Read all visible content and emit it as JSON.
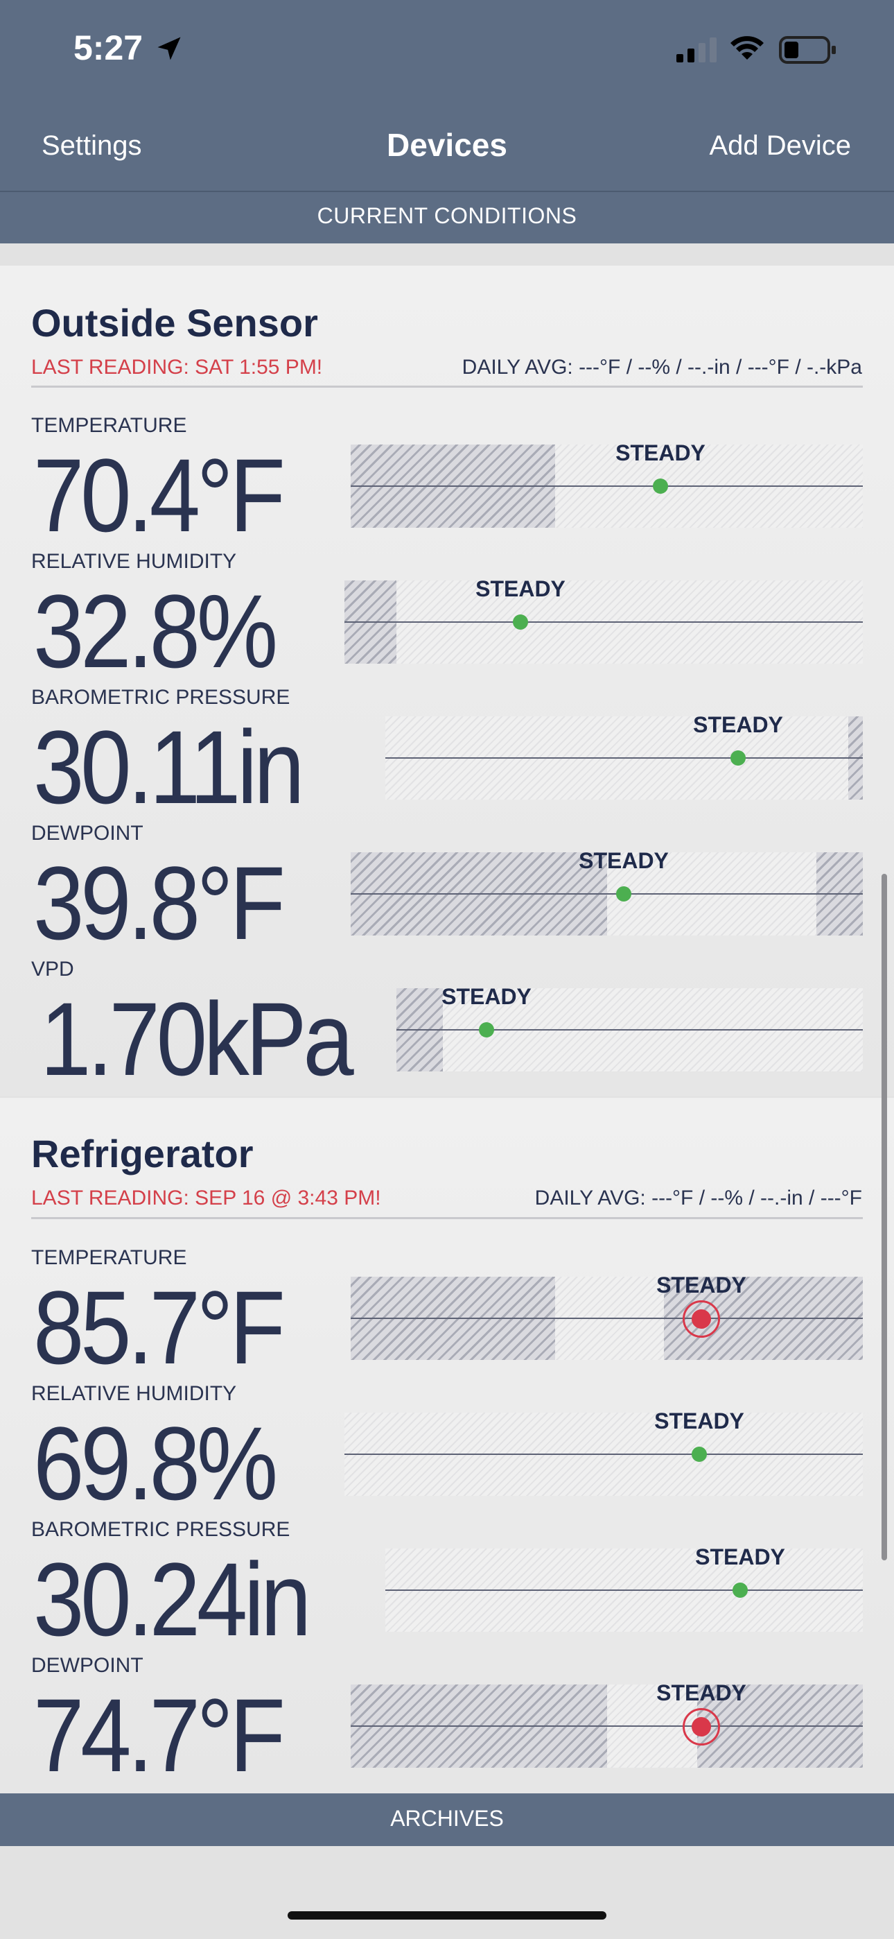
{
  "status_bar": {
    "time": "5:27"
  },
  "nav": {
    "left": "Settings",
    "title": "Devices",
    "right": "Add Device"
  },
  "section_header": "CURRENT CONDITIONS",
  "devices": [
    {
      "name": "Outside Sensor",
      "last_reading": "LAST READING: SAT 1:55 PM!",
      "daily_avg": "DAILY AVG: ---°F / --% / --.-in / ---°F / -.-kPa",
      "metrics": [
        {
          "label": "TEMPERATURE",
          "value": "70.4°F",
          "trend": "STEADY",
          "alert": false
        },
        {
          "label": "RELATIVE HUMIDITY",
          "value": "32.8%",
          "trend": "STEADY",
          "alert": false
        },
        {
          "label": "BAROMETRIC PRESSURE",
          "value": "30.11in",
          "trend": "STEADY",
          "alert": false
        },
        {
          "label": "DEWPOINT",
          "value": "39.8°F",
          "trend": "STEADY",
          "alert": false
        },
        {
          "label": "VPD",
          "value": "1.70kPa",
          "trend": "STEADY",
          "alert": false
        }
      ]
    },
    {
      "name": "Refrigerator",
      "last_reading": "LAST READING: SEP 16 @ 3:43 PM!",
      "daily_avg": "DAILY AVG: ---°F / --% / --.-in / ---°F",
      "metrics": [
        {
          "label": "TEMPERATURE",
          "value": "85.7°F",
          "trend": "STEADY",
          "alert": true
        },
        {
          "label": "RELATIVE HUMIDITY",
          "value": "69.8%",
          "trend": "STEADY",
          "alert": false
        },
        {
          "label": "BAROMETRIC PRESSURE",
          "value": "30.24in",
          "trend": "STEADY",
          "alert": false
        },
        {
          "label": "DEWPOINT",
          "value": "74.7°F",
          "trend": "STEADY",
          "alert": true
        }
      ]
    }
  ],
  "footer": {
    "archives": "ARCHIVES"
  },
  "colors": {
    "header": "#5d6d84",
    "alert": "#d4404a",
    "ok": "#4caf50",
    "text": "#2a3350"
  }
}
